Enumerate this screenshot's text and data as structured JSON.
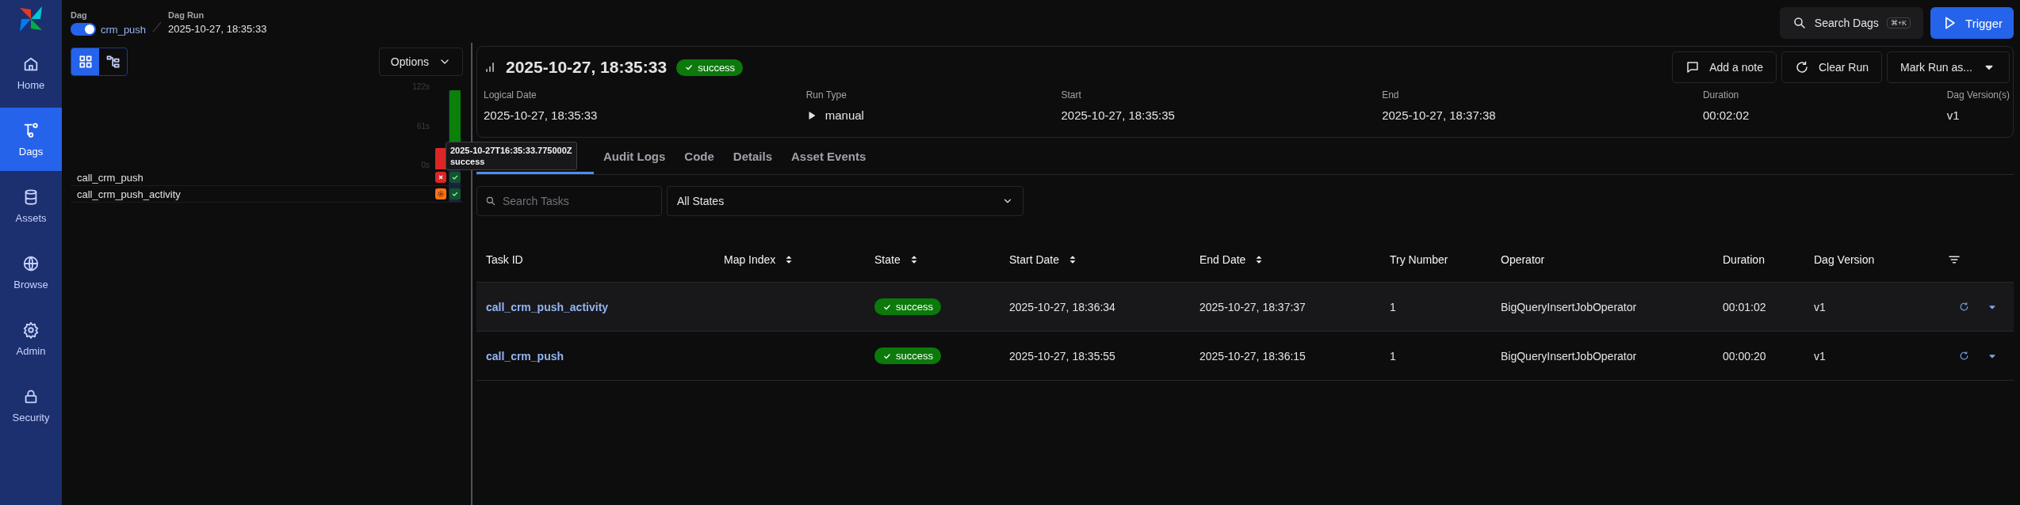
{
  "nav": {
    "items": [
      {
        "label": "Home",
        "selected": false
      },
      {
        "label": "Dags",
        "selected": true
      },
      {
        "label": "Assets",
        "selected": false
      },
      {
        "label": "Browse",
        "selected": false
      },
      {
        "label": "Admin",
        "selected": false
      },
      {
        "label": "Security",
        "selected": false
      }
    ]
  },
  "breadcrumb": {
    "dag_label": "Dag",
    "dag_enabled": true,
    "dag_name": "crm_push",
    "run_label": "Dag Run",
    "run_name": "2025-10-27, 18:35:33"
  },
  "top_actions": {
    "search": {
      "label": "Search Dags",
      "shortcut": "⌘+K"
    },
    "trigger": "Trigger"
  },
  "grid": {
    "views": [
      {
        "selected": true
      },
      {
        "selected": false
      }
    ],
    "options": "Options",
    "axis": [
      "122s",
      "61s",
      "0s"
    ],
    "runs": [
      {
        "kind": "failed",
        "level": 0.27,
        "selected": false
      },
      {
        "kind": "success",
        "level": 1,
        "selected": true
      }
    ],
    "tasks": [
      {
        "name": "call_crm_push",
        "instances": [
          {
            "kind": "failed"
          },
          {
            "kind": "success"
          }
        ]
      },
      {
        "name": "call_crm_push_activity",
        "instances": [
          {
            "kind": "upstream"
          },
          {
            "kind": "success"
          }
        ]
      }
    ],
    "tooltip": {
      "title": "2025-10-27T16:35:33.775000Z",
      "state": "success"
    }
  },
  "run": {
    "title": "2025-10-27, 18:35:33",
    "state": "success",
    "buttons": [
      {
        "label": "Add a note"
      },
      {
        "label": "Clear Run"
      },
      {
        "label": "Mark Run as..."
      }
    ],
    "fields": [
      {
        "label": "Logical Date",
        "value": "2025-10-27, 18:35:33"
      },
      {
        "label": "Run Type",
        "value": "manual"
      },
      {
        "label": "Start",
        "value": "2025-10-27, 18:35:35"
      },
      {
        "label": "End",
        "value": "2025-10-27, 18:37:38"
      },
      {
        "label": "Duration",
        "value": "00:02:02"
      },
      {
        "label": "Dag Version(s)",
        "value": "v1"
      }
    ]
  },
  "tabs": [
    {
      "selected": true
    },
    {
      "label": "Audit Logs",
      "selected": false
    },
    {
      "label": "Code",
      "selected": false
    },
    {
      "label": "Details",
      "selected": false
    },
    {
      "label": "Asset Events",
      "selected": false
    }
  ],
  "filters": {
    "search_placeholder": "Search Tasks",
    "state_filter": "All States"
  },
  "table": {
    "columns": [
      {
        "label": "Task ID",
        "sortable": false
      },
      {
        "label": "Map Index",
        "sortable": true
      },
      {
        "label": "State",
        "sortable": true
      },
      {
        "label": "Start Date",
        "sortable": true
      },
      {
        "label": "End Date",
        "sortable": true
      },
      {
        "label": "Try Number",
        "sortable": false
      },
      {
        "label": "Operator",
        "sortable": false
      },
      {
        "label": "Duration",
        "sortable": false
      },
      {
        "label": "Dag Version",
        "sortable": false
      }
    ],
    "rows": [
      {
        "task_id": "call_crm_push_activity",
        "state": "success",
        "start_date": "2025-10-27, 18:36:34",
        "end_date": "2025-10-27, 18:37:37",
        "try_number": "1",
        "operator": "BigQueryInsertJobOperator",
        "duration": "00:01:02",
        "dag_version": "v1",
        "hovered": true
      },
      {
        "task_id": "call_crm_push",
        "state": "success",
        "start_date": "2025-10-27, 18:35:55",
        "end_date": "2025-10-27, 18:36:15",
        "try_number": "1",
        "operator": "BigQueryInsertJobOperator",
        "duration": "00:00:20",
        "dag_version": "v1",
        "hovered": false
      }
    ]
  }
}
